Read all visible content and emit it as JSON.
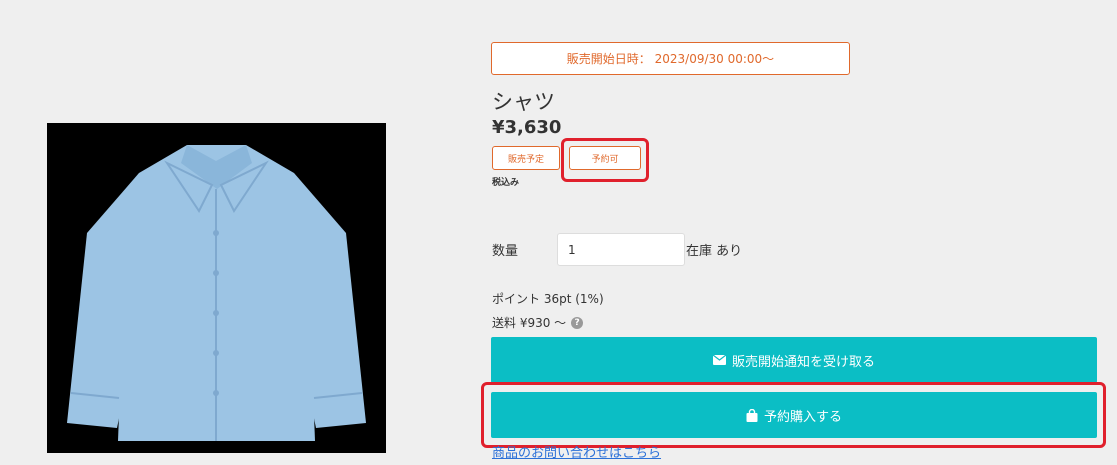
{
  "product": {
    "sale_start": "販売開始日時： 2023/09/30 00:00～",
    "name": "シャツ",
    "price": "¥3,630",
    "badges": [
      "販売予定",
      "予約可"
    ],
    "tax_note": "税込み",
    "image": "shirt illustration"
  },
  "purchase": {
    "quantity_label": "数量",
    "quantity_value": "1",
    "stock_label": "在庫 あり",
    "points": "ポイント 36pt (1%)",
    "shipping": "送料 ¥930 ～",
    "notify_button": "販売開始通知を受け取る",
    "reserve_button": "予約購入する",
    "inquiry_link": "商品のお問い合わせはこちら"
  },
  "colors": {
    "accent": "#e0692c",
    "button": "#0bbec5",
    "highlight": "#e0202c",
    "link": "#2b70d8"
  },
  "icons": {
    "notify": "mail-icon",
    "reserve": "shopping-bag-icon",
    "shipping_help": "help-icon"
  }
}
